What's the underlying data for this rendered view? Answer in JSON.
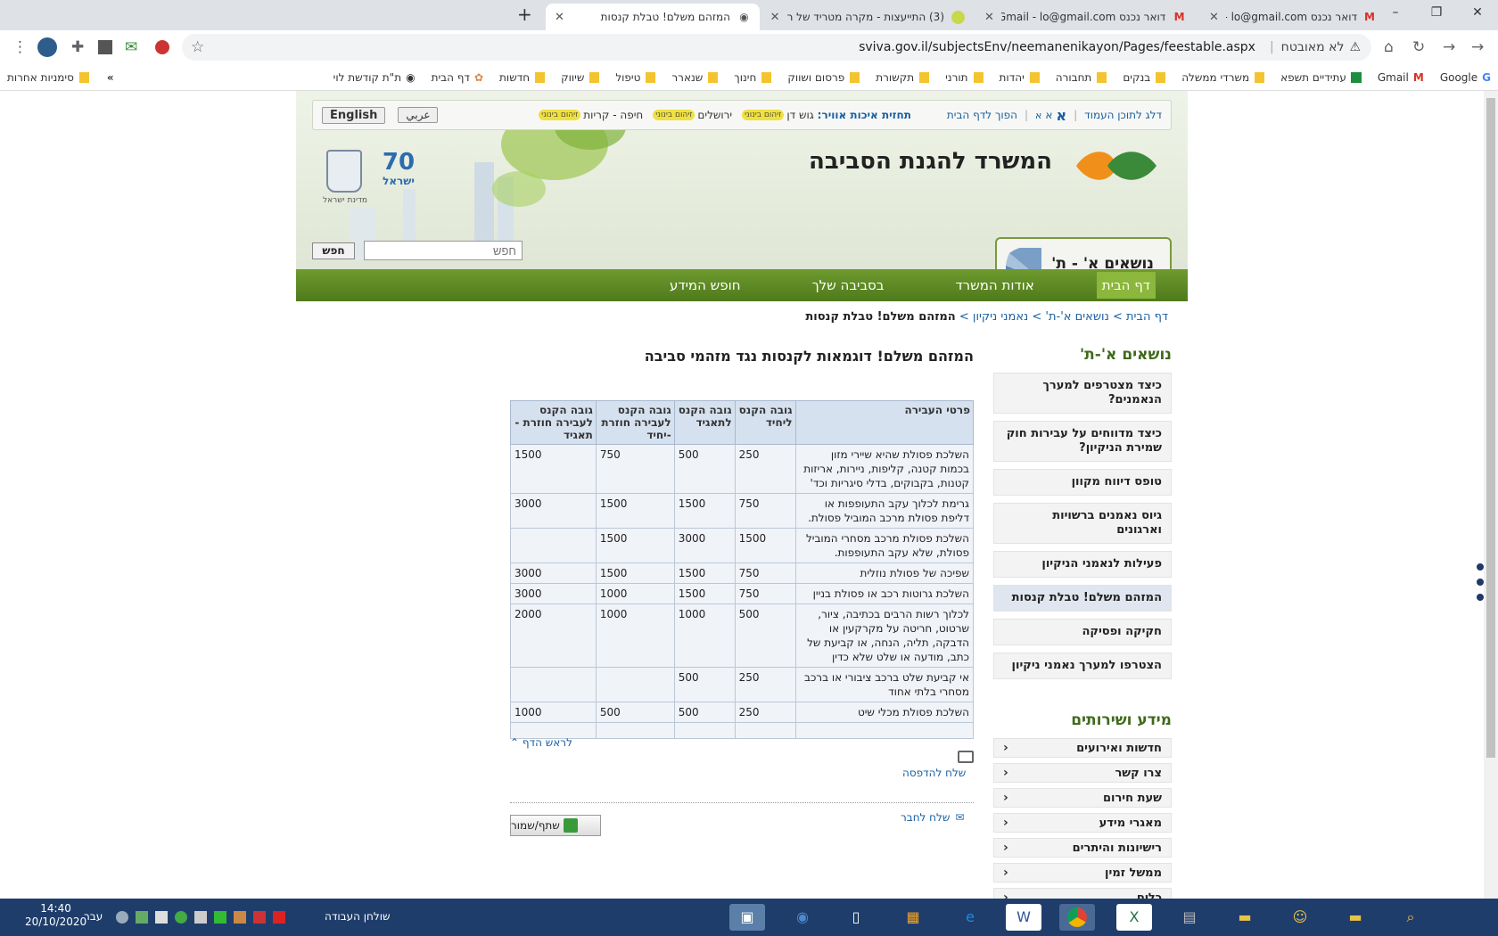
{
  "browser": {
    "tabs": [
      {
        "title": "דואר נכנס Gmail - lo@gmail.com",
        "icon": "gmail-icon"
      },
      {
        "title": "דואר נכנס Gmail - lo@gmail.com",
        "icon": "gmail-icon"
      },
      {
        "title": "(3) התייעצות - מקרה מטריד של ר",
        "icon": "chat-icon"
      },
      {
        "title": "המזהם משלם! טבלת קנסות",
        "icon": "globe-icon",
        "active": true
      }
    ],
    "new_tab": "+",
    "url": "sviva.gov.il/subjectsEnv/neemanenikayon/Pages/feestable.aspx",
    "not_secure": "לא מאובטח",
    "bookmarks": [
      "Google",
      "Gmail",
      "עתידיים תשפא",
      "משרדי ממשלה",
      "בנקים",
      "תחבורה",
      "יהדות",
      "תורני",
      "תקשורת",
      "פרסום ושווק",
      "חינוך",
      "שנארר",
      "טיפול",
      "שיווק",
      "חדשות",
      "דף הבית",
      "ת\"ת קודשת לוי"
    ],
    "bookmarks_more": "»",
    "other_bookmarks": "סימניות אחרות"
  },
  "header": {
    "skip_link": "דלג לתוכן העמוד",
    "font_sizes": [
      "א",
      "א",
      "א"
    ],
    "home_link": "הפוך לדף הבית",
    "air_quality_label": "תחזית איכות אוויר:",
    "regions": [
      {
        "name": "גוש דן",
        "tag": "זיהום בינוני"
      },
      {
        "name": "ירושלים",
        "tag": "זיהום בינוני"
      },
      {
        "name": "חיפה - קריות",
        "tag": "זיהום בינוני"
      }
    ],
    "arabic": "عربي",
    "english": "English",
    "ministry_name": "המשרד להגנת הסביבה",
    "state_label": "מדינת ישראל",
    "israel70": "ישראל",
    "search_placeholder": "חפש",
    "search_button": "חפש",
    "topics_button": "נושאים א' - ת'"
  },
  "nav": [
    "דף הבית",
    "אודות המשרד",
    "בסביבה שלך",
    "חופש המידע"
  ],
  "breadcrumb": {
    "items": [
      "דף הבית",
      "נושאים א'-ת'",
      "נאמני ניקיון"
    ],
    "current": "המזהם משלם! טבלת קנסות",
    "sep": ">"
  },
  "sidebar": {
    "topics_title": "נושאים א'-ת'",
    "topics": [
      "כיצד מצטרפים למערך הנאמנים?",
      "כיצד מדווחים על עבירות חוק שמירת הניקיון?",
      "טופס דיווח מקוון",
      "גיוס נאמנים ברשויות וארגונים",
      "פעילות לנאמני הניקיון",
      "המזהם משלם! טבלת קנסות",
      "חקיקה ופסיקה",
      "הצטרפו למערך נאמני ניקיון"
    ],
    "selected_index": 5,
    "info_title": "מידע ושירותים",
    "info": [
      "חדשות ואירועים",
      "צרו קשר",
      "שעת חירום",
      "מאגרי מידע",
      "רישיונות והיתרים",
      "ממשל זמין",
      "כלים"
    ],
    "chev": "‹"
  },
  "main": {
    "title": "המזהם משלם! דוגמאות לקנסות נגד מזהמי סביבה",
    "headers": [
      "פרטי העבירה",
      "גובה הקנס ליחיד",
      "גובה הקנס לתאגיד",
      "גובה הקנס לעבירה חוזרת -יחיד",
      "גובה הקנס לעבירה חוזרת - תאגיד"
    ],
    "rows": [
      [
        "השלכת פסולת שהיא שיירי מזון בכמות קטנה, קליפות, ניירות, אריזות קטנות, בקבוקים, בדלי סיגריות וכד'",
        "250",
        "500",
        "750",
        "1500"
      ],
      [
        "גרימת לכלוך עקב התעופפות או דליפת פסולת מרכב המוביל פסולת.",
        "750",
        "1500",
        "1500",
        "3000"
      ],
      [
        "השלכת פסולת מרכב מסחרי המוביל פסולת, שלא עקב התעופפות.",
        "1500",
        "3000",
        "1500",
        ""
      ],
      [
        "שפיכה של פסולת נוזלית",
        "750",
        "1500",
        "1500",
        "3000"
      ],
      [
        "השלכת גרוטות רכב או פסולת בניין",
        "750",
        "1500",
        "1000",
        "3000"
      ],
      [
        "לכלוך רשות הרבים בכתיבה, ציור, שרטוט, חריטה על מקרקעין או הדבקה, תליה, הנחה, או קביעת של כתב, מודעה או שלט שלא כדין",
        "500",
        "1000",
        "1000",
        "2000"
      ],
      [
        "אי קביעת שלט ברכב ציבורי או ברכב מסחרי בלתי אחוד",
        "250",
        "500",
        "",
        ""
      ],
      [
        "השלכת פסולת מכלי שיט",
        "250",
        "500",
        "500",
        "1000"
      ],
      [
        "",
        "",
        "",
        "",
        ""
      ]
    ],
    "top_link": "לראש הדף",
    "print_link": "שלח להדפסה",
    "send_link": "שלח לחבר",
    "share_button": "שתף/שמור"
  },
  "taskbar": {
    "time": "14:40",
    "date": "20/10/2020",
    "lang": "עבר",
    "desktop": "שולחן העבודה"
  },
  "colors": {
    "nav_green": "#5b8624",
    "accent_blue": "#1a5fa0",
    "table_header": "#d6e1ef"
  }
}
